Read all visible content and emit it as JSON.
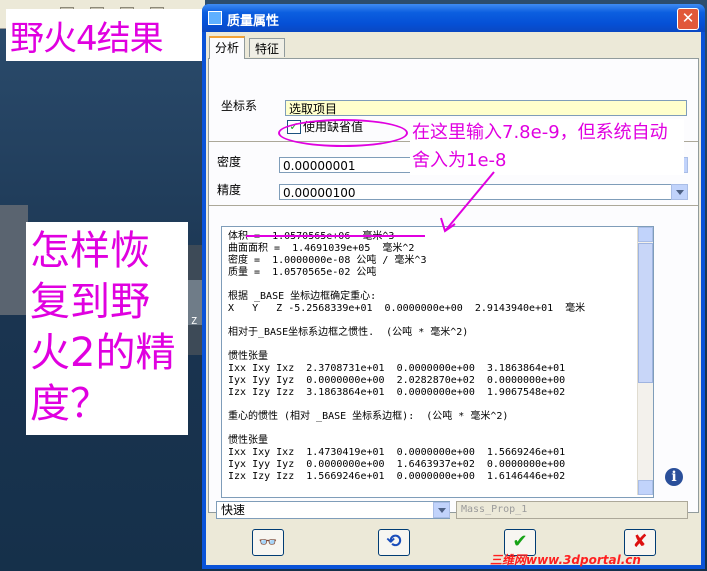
{
  "overlay": {
    "title": "野火4结果",
    "question": "怎样恢复到野火2的精度？",
    "annotation": "在这里输入7.8e-9，但系统自动舍入为1e-8",
    "watermark": "三维网www.3dportal.cn"
  },
  "background": {
    "coord_label": "Z"
  },
  "dialog": {
    "title": "质量属性",
    "close_symbol": "✕",
    "tabs": [
      {
        "label": "分析",
        "active": true
      },
      {
        "label": "特征",
        "active": false
      }
    ],
    "coord_label": "坐标系",
    "coord_value": "选取项目",
    "use_default_label": "使用缺省值",
    "use_default_checked": true,
    "density_label": "密度",
    "density_value": "0.00000001",
    "precision_label": "精度",
    "precision_value": "0.00000100",
    "results_text": "体积 =  1.0570565e+06  毫米^3\n曲面面积 =  1.4691039e+05  毫米^2\n密度 =  1.0000000e-08 公吨 / 毫米^3\n质量 =  1.0570565e-02 公吨\n\n根据 _BASE 坐标边框确定重心:\nX   Y   Z -5.2568339e+01  0.0000000e+00  2.9143940e+01  毫米\n\n相对于_BASE坐标系边框之惯性.  (公吨 * 毫米^2)\n\n惯性张量\nIxx Ixy Ixz  2.3708731e+01  0.0000000e+00  3.1863864e+01\nIyx Iyy Iyz  0.0000000e+00  2.0282870e+02  0.0000000e+00\nIzx Izy Izz  3.1863864e+01  0.0000000e+00  1.9067548e+02\n\n重心的惯性 (相对 _BASE 坐标系边框):  (公吨 * 毫米^2)\n\n惯性张量\nIxx Ixy Ixz  1.4730419e+01  0.0000000e+00  1.5669246e+01\nIyx Iyy Iyz  0.0000000e+00  1.6463937e+02  0.0000000e+00\nIzx Izy Izz  1.5669246e+01  0.0000000e+00  1.6146446e+02",
    "info_symbol": "i",
    "speed_value": "快速",
    "name_value": "Mass_Prop_1",
    "buttons": {
      "glasses": "👓",
      "refresh": "⟲",
      "ok": "✔",
      "cancel": "✘"
    }
  },
  "colors": {
    "annotation": "#e000e0",
    "title_bar": "#0550d6",
    "dialog_face": "#ece9d8"
  }
}
